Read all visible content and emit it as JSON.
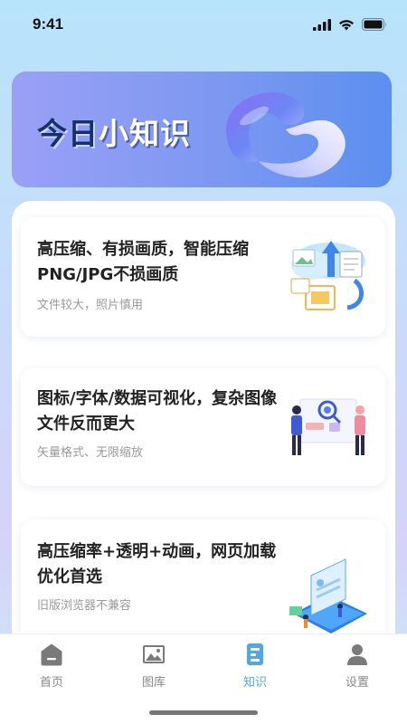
{
  "status_bar": {
    "time": "9:41"
  },
  "banner": {
    "title_part1": "今日",
    "title_part2": "小知识"
  },
  "cards": [
    {
      "title": "高压缩、有损画质，智能压缩PNG/JPG不损画质",
      "subtitle": "文件较大，照片慎用",
      "illustration": "cloud-upload-illustration"
    },
    {
      "title": "图标/字体/数据可视化，复杂图像文件反而更大",
      "subtitle": "矢量格式、无限缩放",
      "illustration": "people-search-illustration"
    },
    {
      "title": "高压缩率+透明+动画，网页加载优化首选",
      "subtitle": "旧版浏览器不兼容",
      "illustration": "isometric-web-illustration"
    }
  ],
  "tab_bar": {
    "active": "knowledge",
    "tabs": [
      {
        "label": "首页",
        "icon": "home-icon"
      },
      {
        "label": "图库",
        "icon": "gallery-icon"
      },
      {
        "label": "知识",
        "icon": "knowledge-icon"
      },
      {
        "label": "设置",
        "icon": "user-icon"
      }
    ]
  },
  "colors": {
    "accent": "#4fa7e6",
    "banner_start": "#9aa0f6",
    "banner_end": "#5b8ff0",
    "title_dark": "#15306f"
  }
}
